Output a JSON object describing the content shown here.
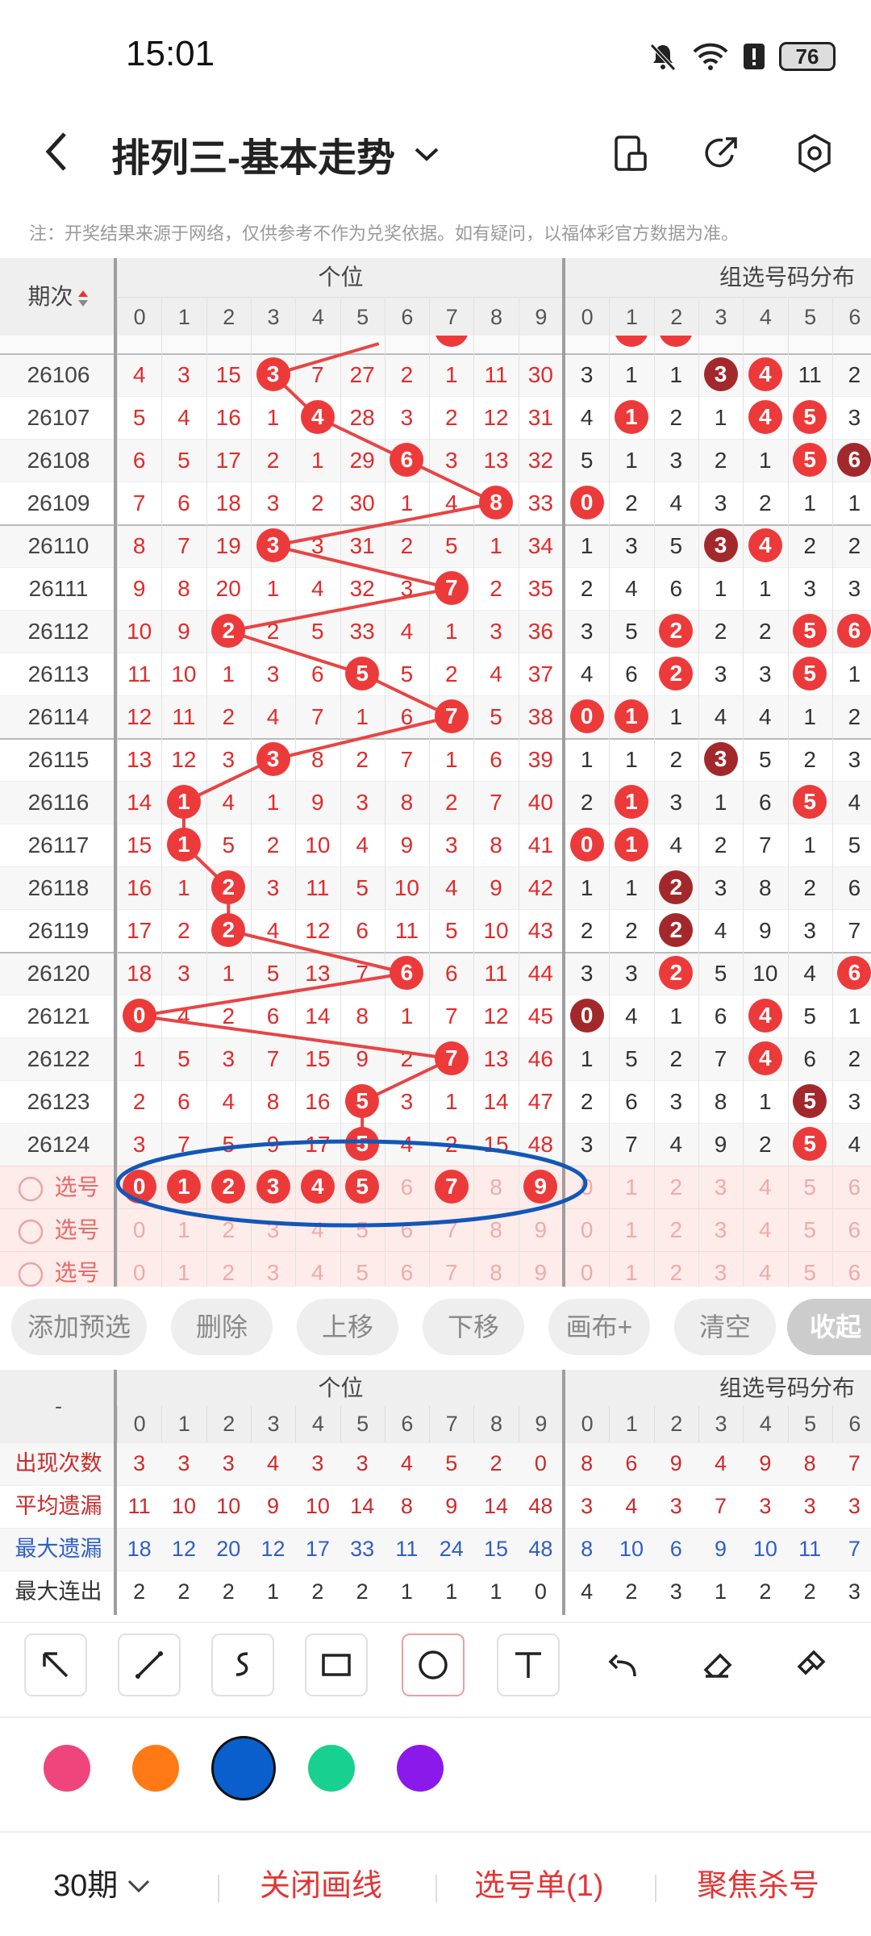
{
  "status": {
    "time": "15:01",
    "battery": "76"
  },
  "header": {
    "title": "排列三-基本走势"
  },
  "note": "注：开奖结果来源于网络，仅供参考不作为兑奖依据。如有疑问，以福体彩官方数据为准。",
  "table": {
    "period_header": "期次",
    "sec1": "个位",
    "sec2": "组选号码分布",
    "digits1": [
      "0",
      "1",
      "2",
      "3",
      "4",
      "5",
      "6",
      "7",
      "8",
      "9"
    ],
    "digits2": [
      "0",
      "1",
      "2",
      "3",
      "4",
      "5",
      "6"
    ],
    "rows": [
      {
        "p": "26106",
        "a": [
          "4",
          "3",
          "15",
          "3",
          "7",
          "27",
          "2",
          "1",
          "11",
          "30"
        ],
        "hit": 3,
        "b": [
          "3",
          "1",
          "1",
          "3",
          "4",
          "11",
          "2"
        ],
        "bh": [
          3,
          4
        ],
        "dk": [
          3
        ]
      },
      {
        "p": "26107",
        "a": [
          "5",
          "4",
          "16",
          "1",
          "4",
          "28",
          "3",
          "2",
          "12",
          "31"
        ],
        "hit": 4,
        "b": [
          "4",
          "1",
          "2",
          "1",
          "4",
          "5",
          "3"
        ],
        "bh": [
          1,
          4,
          5
        ],
        "dk": []
      },
      {
        "p": "26108",
        "a": [
          "6",
          "5",
          "17",
          "2",
          "1",
          "29",
          "6",
          "3",
          "13",
          "32"
        ],
        "hit": 6,
        "b": [
          "5",
          "1",
          "3",
          "2",
          "1",
          "5",
          "6"
        ],
        "bh": [
          5,
          6
        ],
        "dk": [
          6
        ]
      },
      {
        "p": "26109",
        "a": [
          "7",
          "6",
          "18",
          "3",
          "2",
          "30",
          "1",
          "4",
          "8",
          "33"
        ],
        "hit": 8,
        "b": [
          "0",
          "2",
          "4",
          "3",
          "2",
          "1",
          "1"
        ],
        "bh": [
          0
        ],
        "dk": []
      },
      {
        "p": "26110",
        "a": [
          "8",
          "7",
          "19",
          "3",
          "3",
          "31",
          "2",
          "5",
          "1",
          "34"
        ],
        "hit": 3,
        "b": [
          "1",
          "3",
          "5",
          "3",
          "4",
          "2",
          "2"
        ],
        "bh": [
          3,
          4
        ],
        "dk": [
          3
        ]
      },
      {
        "p": "26111",
        "a": [
          "9",
          "8",
          "20",
          "1",
          "4",
          "32",
          "3",
          "7",
          "2",
          "35"
        ],
        "hit": 7,
        "b": [
          "2",
          "4",
          "6",
          "1",
          "1",
          "3",
          "3"
        ],
        "bh": [],
        "dk": []
      },
      {
        "p": "26112",
        "a": [
          "10",
          "9",
          "2",
          "2",
          "5",
          "33",
          "4",
          "1",
          "3",
          "36"
        ],
        "hit": 2,
        "b": [
          "3",
          "5",
          "2",
          "2",
          "2",
          "5",
          "6"
        ],
        "bh": [
          2,
          5,
          6
        ],
        "dk": []
      },
      {
        "p": "26113",
        "a": [
          "11",
          "10",
          "1",
          "3",
          "6",
          "5",
          "5",
          "2",
          "4",
          "37"
        ],
        "hit": 5,
        "b": [
          "4",
          "6",
          "2",
          "3",
          "3",
          "5",
          "1"
        ],
        "bh": [
          2,
          5
        ],
        "dk": []
      },
      {
        "p": "26114",
        "a": [
          "12",
          "11",
          "2",
          "4",
          "7",
          "1",
          "6",
          "7",
          "5",
          "38"
        ],
        "hit": 7,
        "b": [
          "0",
          "1",
          "1",
          "4",
          "4",
          "1",
          "2"
        ],
        "bh": [
          0,
          1
        ],
        "dk": []
      },
      {
        "p": "26115",
        "a": [
          "13",
          "12",
          "3",
          "3",
          "8",
          "2",
          "7",
          "1",
          "6",
          "39"
        ],
        "hit": 3,
        "b": [
          "1",
          "1",
          "2",
          "3",
          "5",
          "2",
          "3"
        ],
        "bh": [
          3
        ],
        "dk": [
          3
        ]
      },
      {
        "p": "26116",
        "a": [
          "14",
          "1",
          "4",
          "1",
          "9",
          "3",
          "8",
          "2",
          "7",
          "40"
        ],
        "hit": 1,
        "b": [
          "2",
          "1",
          "3",
          "1",
          "6",
          "5",
          "4"
        ],
        "bh": [
          1,
          5
        ],
        "dk": []
      },
      {
        "p": "26117",
        "a": [
          "15",
          "1",
          "5",
          "2",
          "10",
          "4",
          "9",
          "3",
          "8",
          "41"
        ],
        "hit": 1,
        "b": [
          "0",
          "1",
          "4",
          "2",
          "7",
          "1",
          "5"
        ],
        "bh": [
          0,
          1
        ],
        "dk": []
      },
      {
        "p": "26118",
        "a": [
          "16",
          "1",
          "2",
          "3",
          "11",
          "5",
          "10",
          "4",
          "9",
          "42"
        ],
        "hit": 2,
        "b": [
          "1",
          "1",
          "2",
          "3",
          "8",
          "2",
          "6"
        ],
        "bh": [
          2
        ],
        "dk": [
          2
        ]
      },
      {
        "p": "26119",
        "a": [
          "17",
          "2",
          "2",
          "4",
          "12",
          "6",
          "11",
          "5",
          "10",
          "43"
        ],
        "hit": 2,
        "b": [
          "2",
          "2",
          "2",
          "4",
          "9",
          "3",
          "7"
        ],
        "bh": [
          2
        ],
        "dk": [
          2
        ]
      },
      {
        "p": "26120",
        "a": [
          "18",
          "3",
          "1",
          "5",
          "13",
          "7",
          "6",
          "6",
          "11",
          "44"
        ],
        "hit": 6,
        "b": [
          "3",
          "3",
          "2",
          "5",
          "10",
          "4",
          "6"
        ],
        "bh": [
          2,
          6
        ],
        "dk": []
      },
      {
        "p": "26121",
        "a": [
          "0",
          "4",
          "2",
          "6",
          "14",
          "8",
          "1",
          "7",
          "12",
          "45"
        ],
        "hit": 0,
        "b": [
          "0",
          "4",
          "1",
          "6",
          "4",
          "5",
          "1"
        ],
        "bh": [
          0,
          4
        ],
        "dk": [
          0
        ]
      },
      {
        "p": "26122",
        "a": [
          "1",
          "5",
          "3",
          "7",
          "15",
          "9",
          "2",
          "7",
          "13",
          "46"
        ],
        "hit": 7,
        "b": [
          "1",
          "5",
          "2",
          "7",
          "4",
          "6",
          "2"
        ],
        "bh": [
          4
        ],
        "dk": []
      },
      {
        "p": "26123",
        "a": [
          "2",
          "6",
          "4",
          "8",
          "16",
          "5",
          "3",
          "1",
          "14",
          "47"
        ],
        "hit": 5,
        "b": [
          "2",
          "6",
          "3",
          "8",
          "1",
          "5",
          "3"
        ],
        "bh": [
          5
        ],
        "dk": [
          5
        ]
      },
      {
        "p": "26124",
        "a": [
          "3",
          "7",
          "5",
          "9",
          "17",
          "5",
          "4",
          "2",
          "15",
          "48"
        ],
        "hit": 5,
        "b": [
          "3",
          "7",
          "4",
          "9",
          "2",
          "5",
          "4"
        ],
        "bh": [
          5
        ],
        "dk": []
      }
    ],
    "pick_label": "选号",
    "pick_selected": [
      0,
      1,
      2,
      3,
      4,
      5,
      7,
      9
    ]
  },
  "buttons": [
    "添加预选",
    "删除",
    "上移",
    "下移",
    "画布+",
    "清空",
    "收起"
  ],
  "stats": {
    "corner": "-",
    "labels": [
      "出现次数",
      "平均遗漏",
      "最大遗漏",
      "最大连出"
    ],
    "label_colors": [
      "#cc2a2a",
      "#cc2a2a",
      "#2f5fc4",
      "#333333"
    ],
    "value_colors": [
      "#cc2a2a",
      "#cc2a2a",
      "#2f5fc4",
      "#333333"
    ],
    "rows": [
      [
        "3",
        "3",
        "3",
        "4",
        "3",
        "3",
        "4",
        "5",
        "2",
        "0",
        "8",
        "6",
        "9",
        "4",
        "9",
        "8",
        "7"
      ],
      [
        "11",
        "10",
        "10",
        "9",
        "10",
        "14",
        "8",
        "9",
        "14",
        "48",
        "3",
        "4",
        "3",
        "7",
        "3",
        "3",
        "3"
      ],
      [
        "18",
        "12",
        "20",
        "12",
        "17",
        "33",
        "11",
        "24",
        "15",
        "48",
        "8",
        "10",
        "6",
        "9",
        "10",
        "11",
        "7"
      ],
      [
        "2",
        "2",
        "2",
        "1",
        "2",
        "2",
        "1",
        "1",
        "1",
        "0",
        "4",
        "2",
        "3",
        "1",
        "2",
        "2",
        "3"
      ]
    ]
  },
  "tools": [
    "arrow-tool-icon",
    "line-tool-icon",
    "curve-tool-icon",
    "rectangle-tool-icon",
    "ellipse-tool-icon",
    "text-tool-icon",
    "undo-icon",
    "eraser-icon",
    "clear-brush-icon"
  ],
  "colors": [
    "#f0457c",
    "#ff7a14",
    "#0a5fcc",
    "#18d08f",
    "#8a19ea"
  ],
  "bottom": {
    "periods": "30期",
    "close_draw": "关闭画线",
    "pick_list": "选号单(1)",
    "focus_kill": "聚焦杀号"
  }
}
